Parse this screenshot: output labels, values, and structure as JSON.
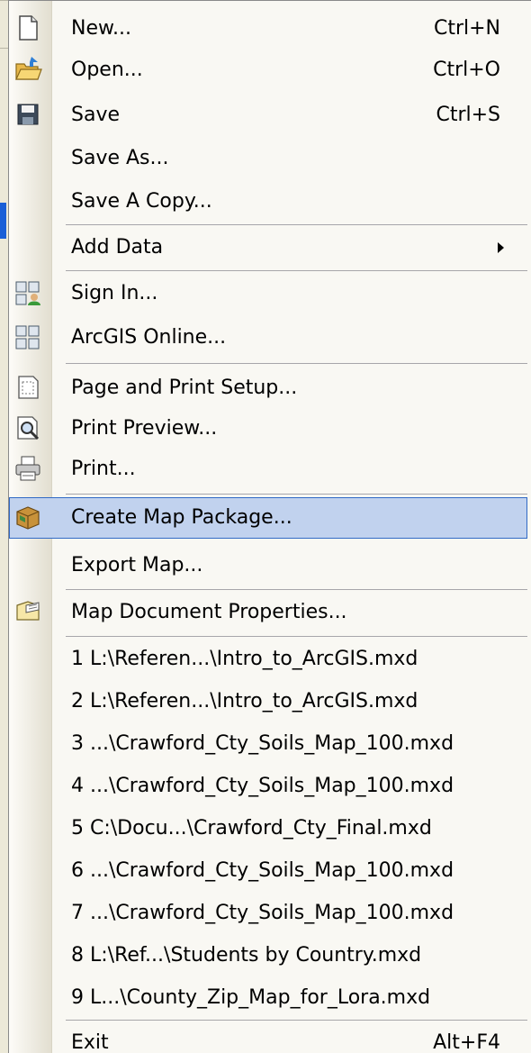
{
  "menu": {
    "items": [
      {
        "label": "New...",
        "shortcut": "Ctrl+N",
        "icon": "new-document-icon"
      },
      {
        "label": "Open...",
        "shortcut": "Ctrl+O",
        "icon": "open-folder-icon"
      },
      {
        "label": "Save",
        "shortcut": "Ctrl+S",
        "icon": "save-disk-icon"
      },
      {
        "label": "Save As..."
      },
      {
        "label": "Save A Copy..."
      },
      {
        "label": "Add Data",
        "submenu": true
      },
      {
        "label": "Sign In...",
        "icon": "sign-in-icon"
      },
      {
        "label": "ArcGIS Online...",
        "icon": "arcgis-online-icon"
      },
      {
        "label": "Page and Print Setup...",
        "icon": "page-setup-icon"
      },
      {
        "label": "Print Preview...",
        "icon": "print-preview-icon"
      },
      {
        "label": "Print...",
        "icon": "printer-icon"
      },
      {
        "label": "Create Map Package...",
        "icon": "map-package-icon",
        "selected": true
      },
      {
        "label": "Export Map..."
      },
      {
        "label": "Map Document Properties...",
        "icon": "document-properties-icon"
      },
      {
        "label": "1 L:\\Referen...\\Intro_to_ArcGIS.mxd"
      },
      {
        "label": "2 L:\\Referen...\\Intro_to_ArcGIS.mxd"
      },
      {
        "label": "3 ...\\Crawford_Cty_Soils_Map_100.mxd"
      },
      {
        "label": "4 ...\\Crawford_Cty_Soils_Map_100.mxd"
      },
      {
        "label": "5 C:\\Docu...\\Crawford_Cty_Final.mxd"
      },
      {
        "label": "6 ...\\Crawford_Cty_Soils_Map_100.mxd"
      },
      {
        "label": "7 ...\\Crawford_Cty_Soils_Map_100.mxd"
      },
      {
        "label": "8 L:\\Ref...\\Students by Country.mxd"
      },
      {
        "label": "9 L...\\County_Zip_Map_for_Lora.mxd"
      },
      {
        "label": "Exit",
        "shortcut": "Alt+F4"
      }
    ]
  },
  "colors": {
    "menu_background": "#f9f8f3",
    "selection_fill": "#c1d2ee",
    "selection_border": "#316ac5",
    "separator": "#a7a6aa"
  }
}
